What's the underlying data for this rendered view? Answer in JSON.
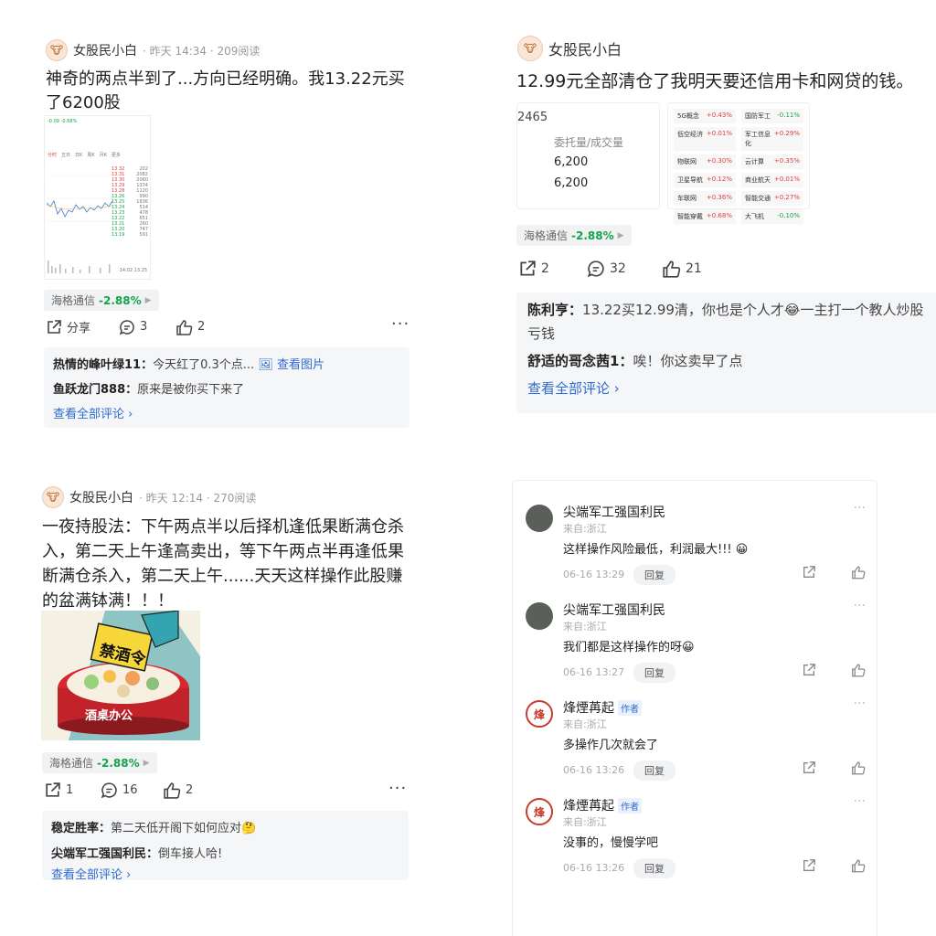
{
  "panel1": {
    "author": "女股民小白",
    "meta": "· 昨天 14:34 · 209阅读",
    "text": "神奇的两点半到了...方向已经明确。我13.22元买了6200股",
    "tag": {
      "name": "海格通信",
      "change": "-2.88%"
    },
    "actions": {
      "share": "分享",
      "comments": "3",
      "likes": "2"
    },
    "comments": [
      {
        "user": "热情的峰叶绿11",
        "text": "今天红了0.3个点...",
        "extra": "查看图片"
      },
      {
        "user": "鱼跃龙门888",
        "text": "原来是被你买下来了"
      }
    ],
    "view_all": "查看全部评论",
    "thumb": {
      "price_change": "-0.09  -0.68%",
      "tabs": [
        "分时",
        "五日",
        "日K",
        "周K",
        "月K",
        "更多"
      ],
      "last_row": "14:02  13.25"
    }
  },
  "panel2": {
    "author": "女股民小白",
    "text": "12.99元全部清仓了我明天要还信用卡和网贷的钱。",
    "order": {
      "code": "2465",
      "header": "委托量/成交量",
      "row1": "6,200",
      "row2": "6,200"
    },
    "sectors": [
      {
        "name": "5G概念",
        "chg": "+0.43%"
      },
      {
        "name": "国防军工",
        "chg": "-0.11%"
      },
      {
        "name": "低空经济",
        "chg": "+0.01%"
      },
      {
        "name": "军工信息化",
        "chg": "+0.29%"
      },
      {
        "name": "物联网",
        "chg": "+0.30%"
      },
      {
        "name": "云计算",
        "chg": "+0.35%"
      },
      {
        "name": "卫星导航",
        "chg": "+0.12%"
      },
      {
        "name": "商业航天",
        "chg": "+0.01%"
      },
      {
        "name": "车联网",
        "chg": "+0.36%"
      },
      {
        "name": "智能交通",
        "chg": "+0.27%"
      },
      {
        "name": "智能穿戴",
        "chg": "+0.68%"
      },
      {
        "name": "大飞机",
        "chg": "-0.10%"
      }
    ],
    "tag": {
      "name": "海格通信",
      "change": "-2.88%"
    },
    "actions": {
      "share": "2",
      "comments": "32",
      "likes": "21"
    },
    "comments": [
      {
        "user": "陈利亨",
        "text": "13.22买12.99清，你也是个人才😂一主打一个教人炒股亏钱"
      },
      {
        "user": "舒适的哥念茜1",
        "text": "唉！你这卖早了点"
      }
    ],
    "view_all": "查看全部评论"
  },
  "panel3": {
    "author": "女股民小白",
    "meta": "· 昨天 12:14 · 270阅读",
    "text": "一夜持股法：下午两点半以后择机逢低果断满仓杀入，第二天上午逢高卖出，等下午两点半再逢低果断满仓杀入，第二天上午......天天这样操作此股赚的盆满钵满！！！",
    "image": {
      "sign": "禁酒令",
      "table": "酒桌办公"
    },
    "tag": {
      "name": "海格通信",
      "change": "-2.88%"
    },
    "actions": {
      "share": "1",
      "comments": "16",
      "likes": "2"
    },
    "comments": [
      {
        "user": "稳定胜率",
        "text": "第二天低开阁下如何应对🤔"
      },
      {
        "user": "尖端军工强国利民",
        "text": "倒车接人哈!"
      }
    ],
    "view_all": "查看全部评论"
  },
  "panel4": {
    "comments": [
      {
        "name": "尖端军工强国利民",
        "badge": "",
        "loc": "来自:浙江",
        "text": "这样操作风险最低，利润最大!!! 😀",
        "time": "06-16 13:29",
        "reply": "回复"
      },
      {
        "name": "尖端军工强国利民",
        "badge": "",
        "loc": "来自:浙江",
        "text": "我们都是这样操作的呀😀",
        "time": "06-16 13:27",
        "reply": "回复"
      },
      {
        "name": "烽煙苒起",
        "badge": "作者",
        "loc": "来自:浙江",
        "text": "多操作几次就会了",
        "time": "06-16 13:26",
        "reply": "回复"
      },
      {
        "name": "烽煙苒起",
        "badge": "作者",
        "loc": "来自:浙江",
        "text": "没事的，慢慢学吧",
        "time": "06-16 13:26",
        "reply": "回复"
      }
    ]
  },
  "colors": {
    "down_green": "#15a34a",
    "up_red": "#e03d3d",
    "link_blue": "#2f6bd1"
  }
}
